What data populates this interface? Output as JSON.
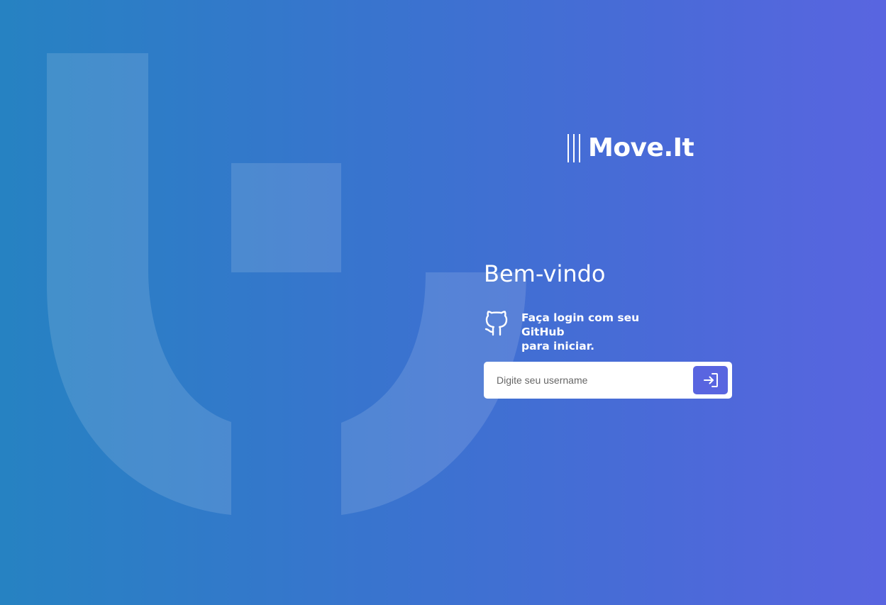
{
  "brand": {
    "name": "Move.It"
  },
  "login": {
    "heading": "Bem-vindo",
    "github_line1": "Faça login com seu GitHub",
    "github_line2": "para iniciar.",
    "username_placeholder": "Digite seu username",
    "username_value": ""
  },
  "icons": {
    "brand_mark": "triple-bar-icon",
    "github": "github-icon",
    "submit": "sign-in-arrow-icon",
    "background": "move-it-logo-watermark"
  },
  "colors": {
    "gradient_start": "#2682c2",
    "gradient_end": "#5965e0",
    "button": "#5965e0",
    "text_light": "#ffffff",
    "placeholder": "#666666"
  }
}
